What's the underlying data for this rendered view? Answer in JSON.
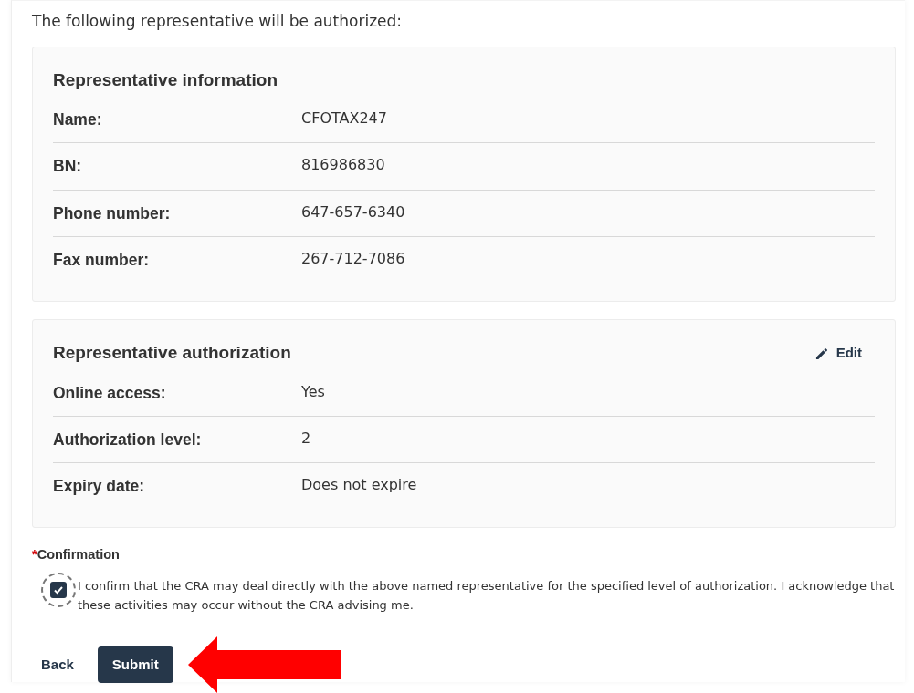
{
  "intro": "The following representative will be authorized:",
  "sections": [
    {
      "title": "Representative information",
      "rows": [
        {
          "label": "Name:",
          "value": "CFOTAX247"
        },
        {
          "label": "BN:",
          "value": "816986830"
        },
        {
          "label": "Phone number:",
          "value": "647-657-6340"
        },
        {
          "label": "Fax number:",
          "value": "267-712-7086"
        }
      ]
    },
    {
      "title": "Representative authorization",
      "edit": "Edit",
      "rows": [
        {
          "label": "Online access:",
          "value": "Yes"
        },
        {
          "label": "Authorization level:",
          "value": "2"
        },
        {
          "label": "Expiry date:",
          "value": "Does not expire"
        }
      ]
    }
  ],
  "confirmation": {
    "required_mark": "*",
    "label": "Confirmation",
    "checked": true,
    "text": "I confirm that the CRA may deal directly with the above named representative for the specified level of authorization. I acknowledge that these activities may occur without the CRA advising me."
  },
  "buttons": {
    "back": "Back",
    "submit": "Submit"
  }
}
